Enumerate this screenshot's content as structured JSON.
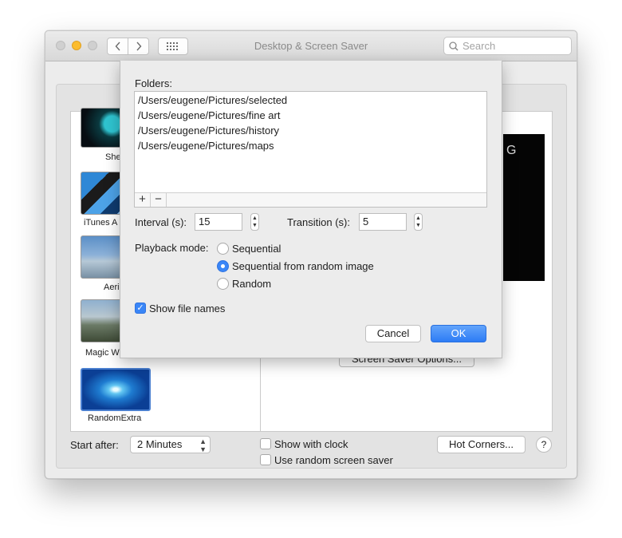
{
  "window": {
    "title": "Desktop & Screen Saver",
    "search_placeholder": "Search"
  },
  "savers": [
    {
      "label": "She",
      "icon": "shell-thumbnail"
    },
    {
      "label": "iTunes A",
      "icon": "itunes-artwork-thumbnail"
    },
    {
      "label": "Aeri",
      "icon": "aerial-thumbnail"
    },
    {
      "label": "Magic W",
      "icon": "magic-window-thumbnail"
    },
    {
      "label": "RandomExtra",
      "icon": "random-extra-thumbnail"
    }
  ],
  "preview": {
    "partial_text": "G",
    "options_button": "Screen Saver Options..."
  },
  "bottom": {
    "start_after_label": "Start after:",
    "start_after_value": "2 Minutes",
    "show_clock_label": "Show with clock",
    "show_clock_checked": false,
    "random_saver_label": "Use random screen saver",
    "random_saver_checked": false,
    "hot_corners": "Hot Corners...",
    "help": "?"
  },
  "sheet": {
    "folders_label": "Folders:",
    "folders": [
      "/Users/eugene/Pictures/selected",
      "/Users/eugene/Pictures/fine art",
      "/Users/eugene/Pictures/history",
      "/Users/eugene/Pictures/maps"
    ],
    "add_symbol": "+",
    "remove_symbol": "−",
    "interval_label": "Interval (s):",
    "interval_value": "15",
    "transition_label": "Transition (s):",
    "transition_value": "5",
    "playback_label": "Playback mode:",
    "playback_options": [
      {
        "label": "Sequential",
        "selected": false
      },
      {
        "label": "Sequential from random image",
        "selected": true
      },
      {
        "label": "Random",
        "selected": false
      }
    ],
    "show_file_names_label": "Show file names",
    "show_file_names_checked": true,
    "cancel_label": "Cancel",
    "ok_label": "OK"
  },
  "colors": {
    "accent": "#3a86f7",
    "minimize": "#fcbc2d"
  }
}
